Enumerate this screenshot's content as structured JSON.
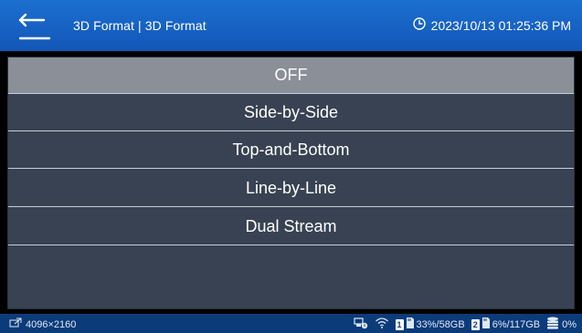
{
  "header": {
    "title": "3D Format | 3D Format",
    "datetime": "2023/10/13 01:25:36 PM"
  },
  "menu": {
    "items": [
      {
        "label": "OFF",
        "selected": true
      },
      {
        "label": "Side-by-Side",
        "selected": false
      },
      {
        "label": "Top-and-Bottom",
        "selected": false
      },
      {
        "label": "Line-by-Line",
        "selected": false
      },
      {
        "label": "Dual Stream",
        "selected": false
      }
    ]
  },
  "status": {
    "resolution": "4096×2160",
    "slot1_number": "1",
    "slot1_usage": "33%/58GB",
    "slot2_number": "2",
    "slot2_usage": "6%/117GB",
    "storage_pct": "0%"
  },
  "colors": {
    "header_blue": "#1565c8",
    "menu_bg": "#384252",
    "selected_bg": "#8a8f98",
    "status_bg": "#0c3b7a"
  },
  "icons": [
    "back-arrow-icon",
    "clock-icon",
    "hdmi-input-icon",
    "network-device-icon",
    "wifi-icon",
    "sd-card-icon",
    "storage-stack-icon"
  ]
}
